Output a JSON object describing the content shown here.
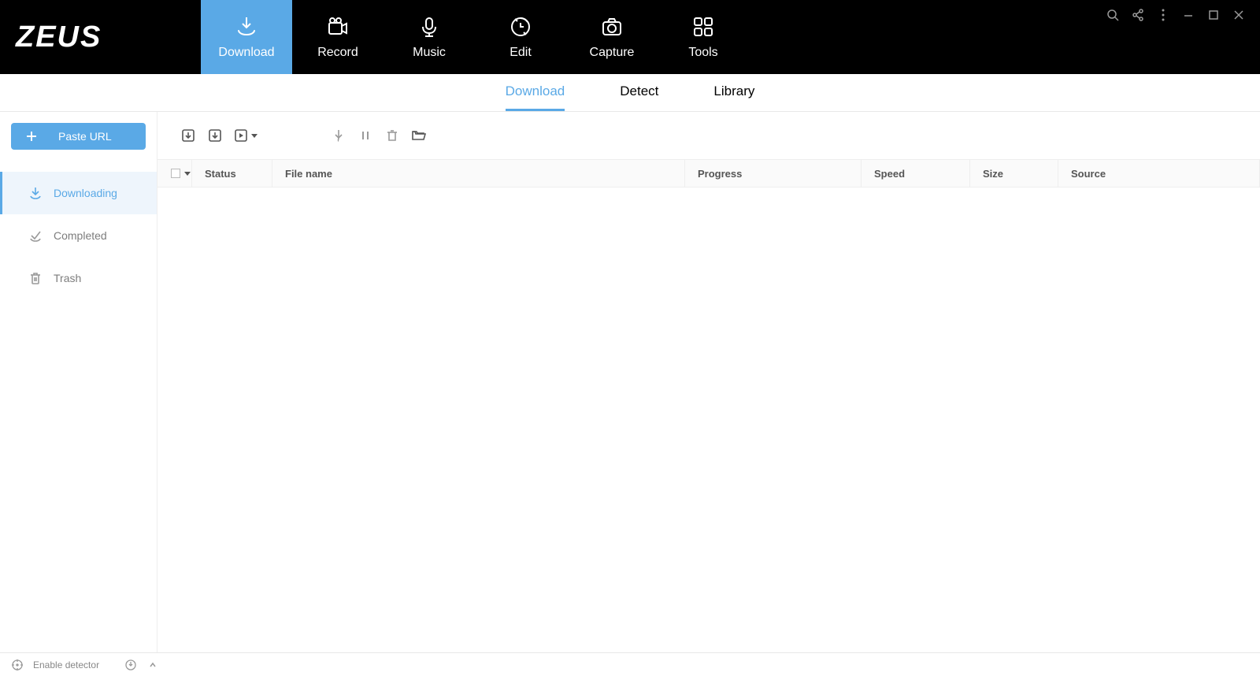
{
  "app": {
    "name": "ZEUS"
  },
  "nav": {
    "download": "Download",
    "record": "Record",
    "music": "Music",
    "edit": "Edit",
    "capture": "Capture",
    "tools": "Tools"
  },
  "subtabs": {
    "download": "Download",
    "detect": "Detect",
    "library": "Library"
  },
  "sidebar": {
    "paste_url": "Paste URL",
    "downloading": "Downloading",
    "completed": "Completed",
    "trash": "Trash"
  },
  "columns": {
    "status": "Status",
    "file_name": "File name",
    "progress": "Progress",
    "speed": "Speed",
    "size": "Size",
    "source": "Source"
  },
  "bottom": {
    "enable_detector": "Enable detector"
  }
}
